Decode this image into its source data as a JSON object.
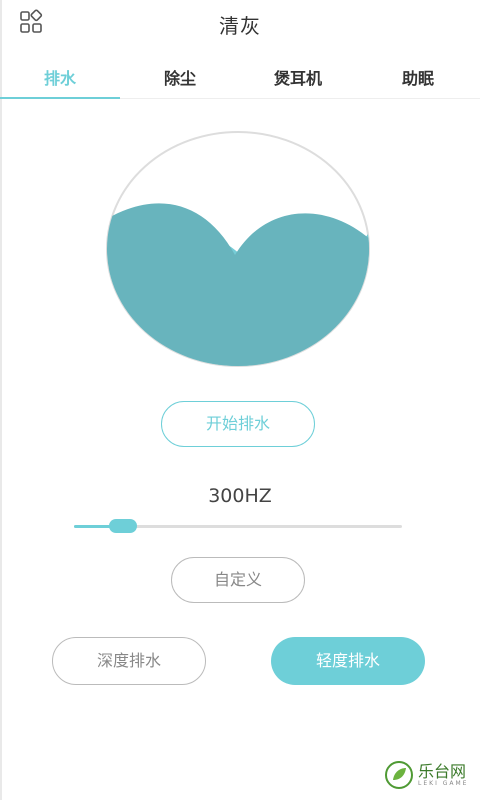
{
  "header": {
    "title": "清灰",
    "menu_icon": "grid-menu-icon"
  },
  "tabs": [
    {
      "label": "排水",
      "active": true
    },
    {
      "label": "除尘",
      "active": false
    },
    {
      "label": "煲耳机",
      "active": false
    },
    {
      "label": "助眠",
      "active": false
    }
  ],
  "main": {
    "start_button": "开始排水",
    "frequency": "300HZ",
    "slider_level": 0.15,
    "custom_button": "自定义",
    "deep_button": "深度排水",
    "light_button": "轻度排水"
  },
  "colors": {
    "accent": "#6ecfd8",
    "wave_light": "#76ccd6",
    "wave_dark": "#68b4bd"
  },
  "watermark": {
    "text": "乐台网",
    "sub": "LEKI GAME"
  }
}
